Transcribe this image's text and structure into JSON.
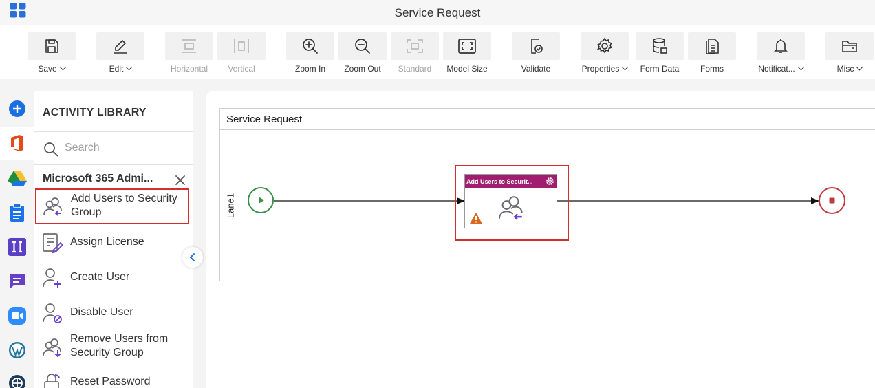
{
  "window": {
    "title": "Service Request"
  },
  "toolbar": {
    "items": [
      {
        "id": "save",
        "label": "Save",
        "icon": "save-icon",
        "dropdown": true,
        "disabled": false
      },
      {
        "id": "edit",
        "label": "Edit",
        "icon": "pencil-icon",
        "dropdown": true,
        "disabled": false
      },
      {
        "id": "horizontal",
        "label": "Horizontal",
        "icon": "horizontal-layout-icon",
        "dropdown": false,
        "disabled": true
      },
      {
        "id": "vertical",
        "label": "Vertical",
        "icon": "vertical-layout-icon",
        "dropdown": false,
        "disabled": true
      },
      {
        "id": "zoom-in",
        "label": "Zoom In",
        "icon": "zoom-in-icon",
        "dropdown": false,
        "disabled": false
      },
      {
        "id": "zoom-out",
        "label": "Zoom Out",
        "icon": "zoom-out-icon",
        "dropdown": false,
        "disabled": false
      },
      {
        "id": "standard",
        "label": "Standard",
        "icon": "standard-size-icon",
        "dropdown": false,
        "disabled": true
      },
      {
        "id": "model-size",
        "label": "Model Size",
        "icon": "fit-to-screen-icon",
        "dropdown": false,
        "disabled": false
      },
      {
        "id": "validate",
        "label": "Validate",
        "icon": "validate-icon",
        "dropdown": false,
        "disabled": false
      },
      {
        "id": "properties",
        "label": "Properties",
        "icon": "gear-icon",
        "dropdown": true,
        "disabled": false
      },
      {
        "id": "form-data",
        "label": "Form Data",
        "icon": "database-icon",
        "dropdown": false,
        "disabled": false
      },
      {
        "id": "forms",
        "label": "Forms",
        "icon": "form-icon",
        "dropdown": false,
        "disabled": false
      },
      {
        "id": "notifications",
        "label": "Notificat...",
        "icon": "bell-icon",
        "dropdown": true,
        "disabled": false
      },
      {
        "id": "misc",
        "label": "Misc",
        "icon": "folder-icon",
        "dropdown": true,
        "disabled": false
      }
    ]
  },
  "rail": {
    "items": [
      "add-icon",
      "office-365-icon",
      "google-drive-icon",
      "clipboard-icon",
      "ii-app-icon",
      "chat-icon",
      "zoom-icon",
      "wordpress-icon",
      "globe-icon"
    ]
  },
  "library": {
    "title": "ACTIVITY LIBRARY",
    "search_placeholder": "Search",
    "group_title": "Microsoft 365 Admi...",
    "items": [
      {
        "label": "Add Users to Security Group",
        "icon": "add-users-icon",
        "selected": true
      },
      {
        "label": "Assign License",
        "icon": "assign-license-icon",
        "selected": false
      },
      {
        "label": "Create User",
        "icon": "create-user-icon",
        "selected": false
      },
      {
        "label": "Disable User",
        "icon": "disable-user-icon",
        "selected": false
      },
      {
        "label": "Remove Users from Security Group",
        "icon": "remove-users-icon",
        "selected": false
      },
      {
        "label": "Reset Password",
        "icon": "reset-password-icon",
        "selected": false
      }
    ]
  },
  "canvas": {
    "pool_title": "Service Request",
    "lane_label": "Lane1",
    "activity_title": "Add Users to Securit...",
    "colors": {
      "activity_header": "#a01d6f",
      "start_event": "#3b8e4c",
      "end_event": "#c0393b",
      "highlight": "#d32f2f",
      "warning": "#d9691f"
    }
  }
}
